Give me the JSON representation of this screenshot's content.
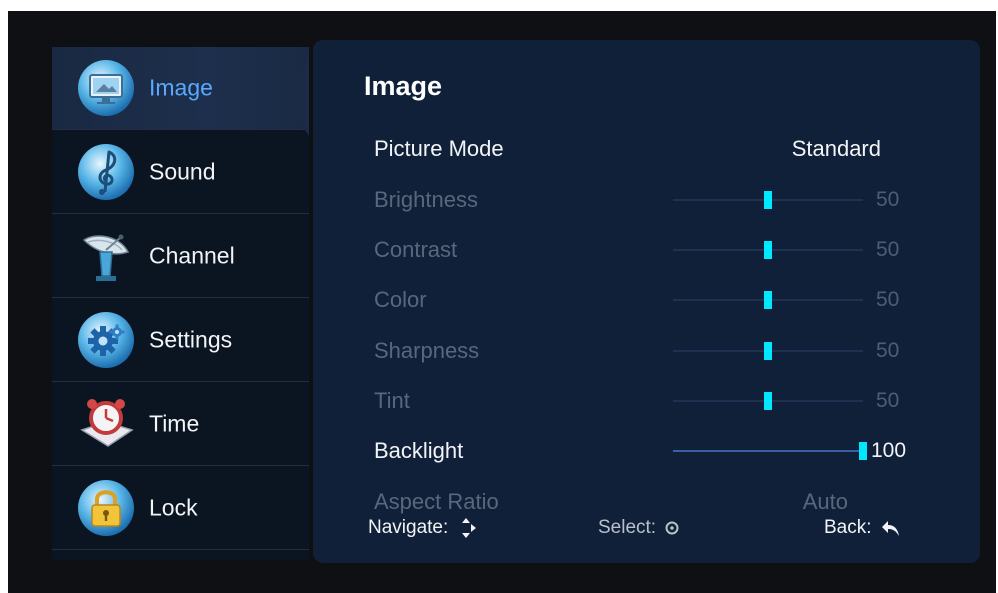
{
  "menu": {
    "items": [
      {
        "label": "Image",
        "icon": "monitor-icon",
        "active": true
      },
      {
        "label": "Sound",
        "icon": "music-note-icon",
        "active": false
      },
      {
        "label": "Channel",
        "icon": "satellite-dish-icon",
        "active": false
      },
      {
        "label": "Settings",
        "icon": "gear-icon",
        "active": false
      },
      {
        "label": "Time",
        "icon": "alarm-clock-icon",
        "active": false
      },
      {
        "label": "Lock",
        "icon": "padlock-icon",
        "active": false
      }
    ]
  },
  "panel": {
    "title": "Image",
    "rows": [
      {
        "name": "Picture Mode",
        "value": "Standard",
        "enabled": true
      },
      {
        "name": "Brightness",
        "value": "50",
        "level": 50,
        "enabled": false
      },
      {
        "name": "Contrast",
        "value": "50",
        "level": 50,
        "enabled": false
      },
      {
        "name": "Color",
        "value": "50",
        "level": 50,
        "enabled": false
      },
      {
        "name": "Sharpness",
        "value": "50",
        "level": 50,
        "enabled": false
      },
      {
        "name": "Tint",
        "value": "50",
        "level": 50,
        "enabled": false
      },
      {
        "name": "Backlight",
        "value": "100",
        "level": 100,
        "enabled": true
      },
      {
        "name": "Aspect Ratio",
        "value": "Auto",
        "enabled": false
      }
    ]
  },
  "footer": {
    "navigate": "Navigate:",
    "select": "Select:",
    "back": "Back:"
  },
  "colors": {
    "accent": "#5aa8ff",
    "slider_thumb": "#00e8ff",
    "panel_bg": "#102039"
  }
}
